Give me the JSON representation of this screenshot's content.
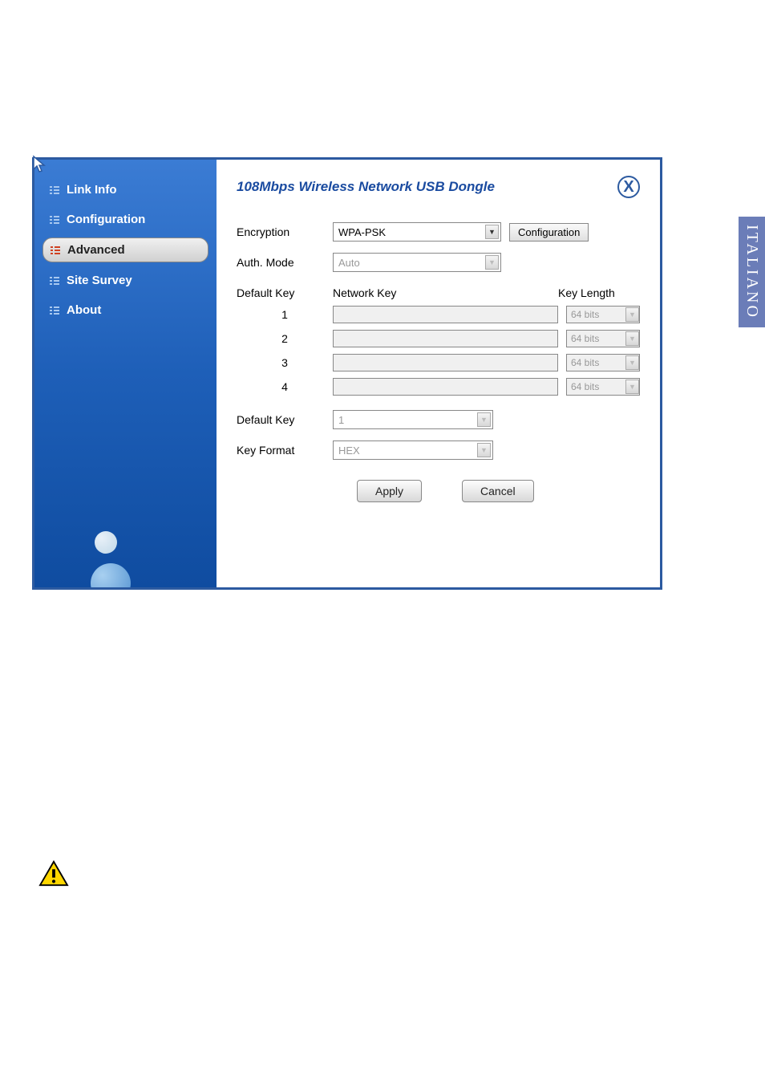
{
  "side_tab": "ITALIANO",
  "sidebar": {
    "items": [
      {
        "label": "Link Info"
      },
      {
        "label": "Configuration"
      },
      {
        "label": "Advanced"
      },
      {
        "label": "Site Survey"
      },
      {
        "label": "About"
      }
    ]
  },
  "header": {
    "title": "108Mbps Wireless Network USB Dongle",
    "close": "X"
  },
  "form": {
    "encryption_label": "Encryption",
    "encryption_value": "WPA-PSK",
    "config_button": "Configuration",
    "auth_label": "Auth. Mode",
    "auth_value": "Auto",
    "table": {
      "default_key_header": "Default Key",
      "network_key_header": "Network Key",
      "key_length_header": "Key Length",
      "rows": [
        {
          "num": "1",
          "len": "64 bits"
        },
        {
          "num": "2",
          "len": "64 bits"
        },
        {
          "num": "3",
          "len": "64 bits"
        },
        {
          "num": "4",
          "len": "64 bits"
        }
      ]
    },
    "default_key_label": "Default Key",
    "default_key_value": "1",
    "key_format_label": "Key Format",
    "key_format_value": "HEX",
    "apply": "Apply",
    "cancel": "Cancel"
  }
}
